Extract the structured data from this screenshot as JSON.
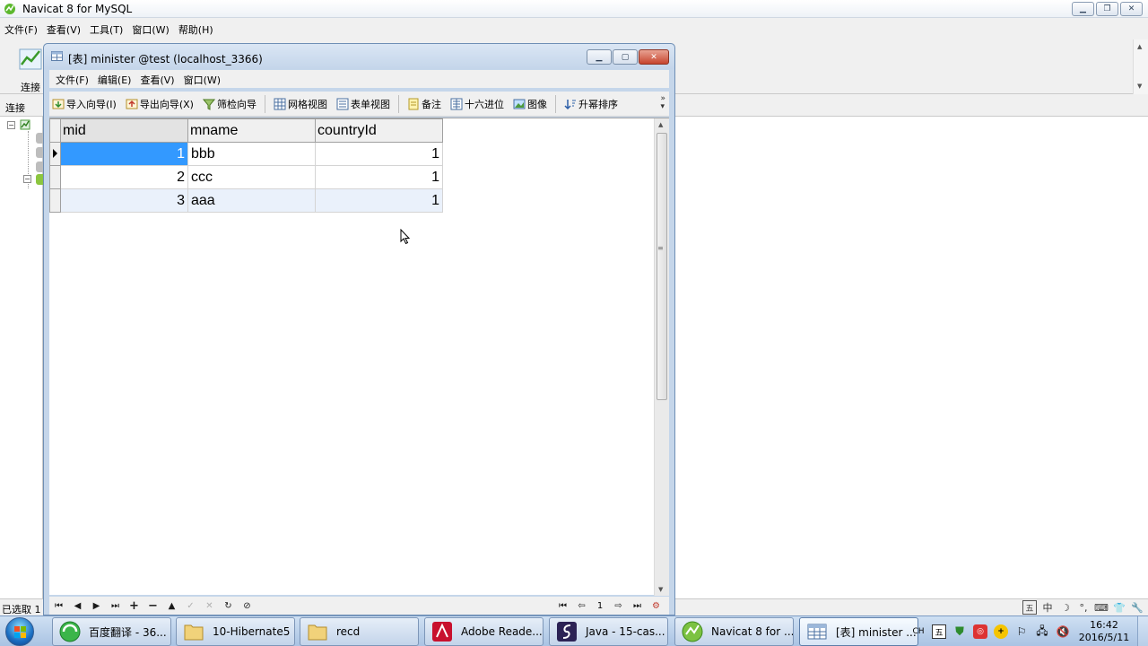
{
  "main_window": {
    "title": "Navicat 8 for MySQL",
    "menu": [
      "文件(F)",
      "查看(V)",
      "工具(T)",
      "窗口(W)",
      "帮助(H)"
    ],
    "toolbar": {
      "connect_label": "连接"
    },
    "left_pane_header": "连接",
    "status_text": "已选取 1",
    "ime_indicator": "中"
  },
  "child_window": {
    "title": "[表] minister @test (localhost_3366)",
    "menu": [
      "文件(F)",
      "编辑(E)",
      "查看(V)",
      "窗口(W)"
    ],
    "toolbar": {
      "import": "导入向导(I)",
      "export": "导出向导(X)",
      "filter": "筛检向导",
      "grid_view": "网格视图",
      "form_view": "表单视图",
      "memo": "备注",
      "hex": "十六进位",
      "image": "图像",
      "sort": "升幂排序"
    },
    "grid": {
      "columns": [
        "mid",
        "mname",
        "countryId"
      ],
      "rows": [
        [
          "1",
          "bbb",
          "1"
        ],
        [
          "2",
          "ccc",
          "1"
        ],
        [
          "3",
          "aaa",
          "1"
        ]
      ],
      "selected_row": 0
    },
    "nav": {
      "page": "1"
    }
  },
  "taskbar": {
    "items": [
      {
        "label": "百度翻译 - 36...",
        "icon": "browser-icon"
      },
      {
        "label": "10-Hibernate5",
        "icon": "folder-icon"
      },
      {
        "label": "recd",
        "icon": "folder-icon"
      },
      {
        "label": "Adobe Reade...",
        "icon": "adobe-reader-icon"
      },
      {
        "label": "Java - 15-cas...",
        "icon": "eclipse-icon"
      },
      {
        "label": "Navicat 8 for ...",
        "icon": "navicat-icon"
      },
      {
        "label": "[表] minister ...",
        "icon": "table-window-icon"
      }
    ],
    "tray": {
      "lang": "CH"
    },
    "clock": {
      "time": "16:42",
      "date": "2016/5/11"
    }
  },
  "colors": {
    "selection": "#3399ff",
    "alt_row": "#eaf1fb",
    "child_frame": "#c5d6ea",
    "taskbar": "#b9d0ec"
  }
}
